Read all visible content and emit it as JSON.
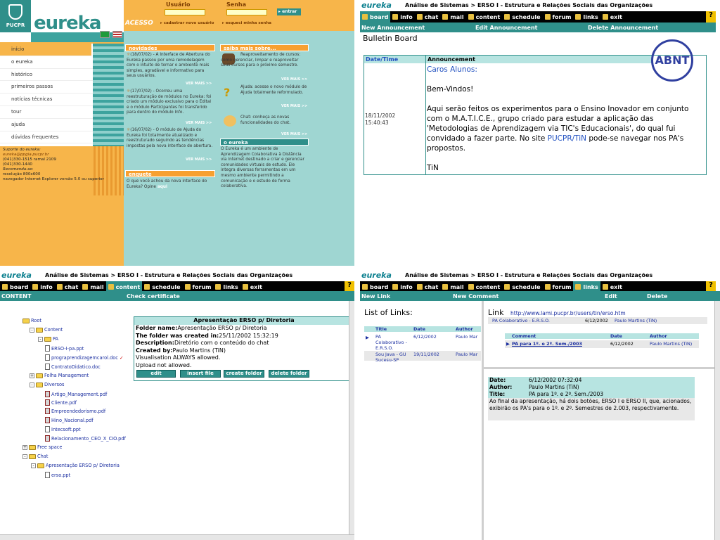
{
  "q1": {
    "crest_label": "PUCPR",
    "logo": "eureka",
    "menu": [
      "início",
      "o eureka",
      "histórico",
      "primeiros passos",
      "notícias técnicas",
      "tour",
      "ajuda",
      "dúvidas frequentes"
    ],
    "support": [
      {
        "t": "Suporte do eureka:",
        "i": true
      },
      {
        "t": "eureka@ppgia.pucpr.br",
        "i": true
      },
      {
        "t": "(041)330-1515 ramal 2109",
        "i": false
      },
      {
        "t": "(041)330-1440",
        "i": false
      },
      {
        "t": "Recomenda-se:",
        "i": true
      },
      {
        "t": "resolução 800x600",
        "i": false
      },
      {
        "t": "navegador Internet Explorer versão 5.0 ou superior",
        "i": false
      }
    ],
    "acesso": "ACESSO",
    "usuario_label": "Usuário",
    "senha_label": "Senha",
    "entrar": "entrar",
    "cadastrar": "cadastrar novo usuário",
    "esqueci": "esqueci minha senha",
    "novidades_head": "novidades",
    "news": [
      "(18/07/02) - A Interface de Abertura do Eureka passou por uma remodelagem com o intuito de tornar o ambiente mais simples, agradável e informativo para seus usuários.",
      "(17/07/02) - Ocorreu uma reestruturação de módulos no Eureka: foi criado um módulo exclusivo para o Edital e o módulo Participantes foi transferido para dentro do módulo Info.",
      "(16/07/02) - O módulo de Ajuda do Eureka foi totalmente atualizado e reestruturado seguindo as tendências impostas pela nova interface de abertura."
    ],
    "vermais": "VER MAIS >>",
    "enquete_head": "enquete",
    "enquete_text": "O que você achou da nova interface do Eureka? Opine",
    "enquete_link": "aqui",
    "saiba_head": "saiba mais sobre...",
    "saiba": [
      "Reaproveitamento de cursos: como gerenciar, limpar e reaproveitar seus cursos para o próximo semestre.",
      "Ajuda: acesse o novo módulo de Ajuda totalmente reformulado.",
      "Chat: conheça as novas funcionalidades do chat."
    ],
    "oeureka_head": "o eureka",
    "oeureka_text": "O Eureka é um ambiente de Aprendizagem Colaborativa à Distância via Internet destinado a criar e gerenciar comunidades virtuais de estudo. Ele integra diversas ferramentas em um mesmo ambiente permitindo a comunicação e o estudo de forma colaborativa."
  },
  "nav": [
    "board",
    "info",
    "chat",
    "mail",
    "content",
    "schedule",
    "forum",
    "links",
    "exit"
  ],
  "help": "?",
  "eureka_small": "eureka",
  "q2": {
    "breadcrumb": "Análise de Sistemas > ERSO I - Estrutura e Relações Sociais das Organizações",
    "sub": [
      "New Announcement",
      "Edit Announcement",
      "Delete Announcement"
    ],
    "title": "Bulletin Board",
    "col_date": "Date/Time",
    "col_ann": "Announcement",
    "date": "18/11/2002",
    "time": "15:40:43",
    "abnt": "ABNT",
    "greet": "Caros Alunos:",
    "welcome": "Bem-Vindos!",
    "body": "Aqui serão feitos os experimentos para o Ensino Inovador em conjunto com o M.A.T.I.C.E., grupo criado para estudar a aplicação das 'Metodologias de Aprendizagem via TIC's Educacionais', do qual fui convidado a fazer parte. No site",
    "site": "PUCPR/TiN",
    "body2": "pode-se navegar nos PA's propostos.",
    "sign": "TiN"
  },
  "q3": {
    "breadcrumb": "Análise de Sistemas > ERSO I - Estrutura e Relações Sociais das Organizações",
    "sub": [
      "CONTENT",
      "Check certificate"
    ],
    "tree": [
      "Root",
      "Content",
      "PA",
      "ERSO-I-pa.ppt",
      "prograprendizagemcarol.doc",
      "ContratoDidatico.doc",
      "Folha Management",
      "Diversos",
      "Artigo_Management.pdf",
      "Cliente.pdf",
      "Empreendedorismo.pdf",
      "Hino_Nacional.pdf",
      "Intecsoft.ppt",
      "Relacionamento_CEO_X_CIO.pdf",
      "Free space",
      "Chat",
      "Apresentação ERSO p/ Diretoria",
      "erso.ppt"
    ],
    "panel_title": "Apresentação ERSO p/ Diretoria",
    "fields": [
      {
        "k": "Folder name:",
        "v": "Apresentação ERSO p/ Diretoria"
      },
      {
        "k": "The folder was created in:",
        "v": "25/11/2002 15:32:19"
      },
      {
        "k": "Description:",
        "v": "Diretório com o conteúdo do chat"
      },
      {
        "k": "Created by:",
        "v": "Paulo Martins (TiN)"
      }
    ],
    "vis": "Visualisation ALWAYS allowed.",
    "upload": "Upload not allowed.",
    "btns": [
      "edit",
      "insert file",
      "create folder",
      "delete folder"
    ]
  },
  "q4": {
    "breadcrumb": "Análise de Sistemas > ERSO I - Estrutura e Relações Sociais das Organizações",
    "sub": [
      "New Link",
      "New Comment",
      "Edit",
      "Delete"
    ],
    "list_title": "List of Links:",
    "cols": [
      "Title",
      "Date",
      "Author"
    ],
    "rows": [
      {
        "title": "PA Colaborativo - E.R.S.O.",
        "date": "6/12/2002",
        "author": "Paulo Mar"
      },
      {
        "title": "Sou Java - GU Sucesu-SP",
        "date": "19/11/2002",
        "author": "Paulo Mar"
      }
    ],
    "link_label": "Link",
    "link_url": "http://www.lami.pucpr.br/users/tin/erso.htm",
    "link_meta": {
      "title": "PA Colaborativo - E.R.S.O.",
      "date": "6/12/2002",
      "author": "Paulo Martins (TiN)"
    },
    "ccols": [
      "Comment",
      "Date",
      "Author"
    ],
    "comment": {
      "title": "PA para 1º. e 2º. Sem./2003",
      "date": "6/12/2002",
      "author": "Paulo Martins (TiN)"
    },
    "detail": [
      {
        "k": "Date:",
        "v": "6/12/2002 07:32:04"
      },
      {
        "k": "Author:",
        "v": "Paulo Martins (TiN)"
      },
      {
        "k": "Title:",
        "v": "PA para 1º. e 2º. Sem./2003"
      }
    ],
    "message": "Ao final da apresentação, há dois botões, ERSO I e ERSO II, que, acionados, exibirão os PA's para o 1º. e 2º. Semestres de 2.003, respectivamente."
  }
}
